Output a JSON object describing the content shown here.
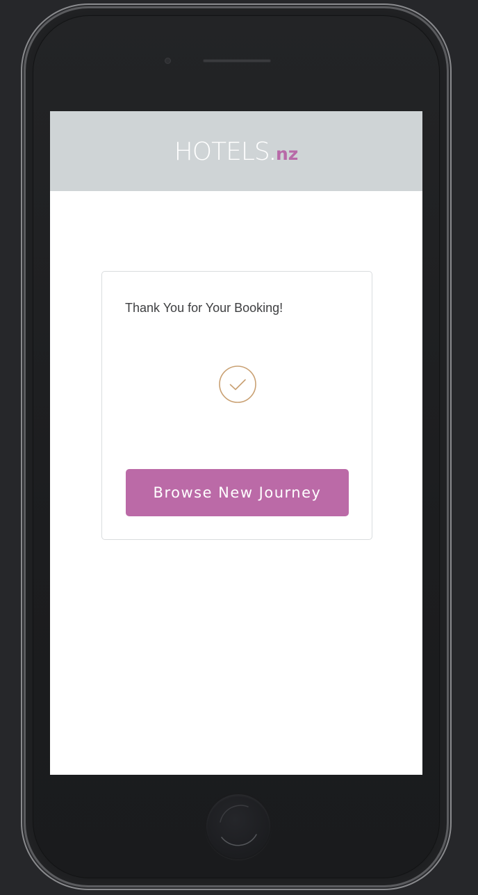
{
  "header": {
    "logo_main": "HOTELS",
    "logo_dot": ".",
    "logo_tld": "nz"
  },
  "confirmation": {
    "title": "Thank You for Your Booking!",
    "icon": "check-circle-icon",
    "button_label": "Browse New Journey"
  },
  "colors": {
    "header_bg": "#cfd4d6",
    "brand_accent": "#bb6aa7",
    "check_gold": "#c9a072"
  }
}
